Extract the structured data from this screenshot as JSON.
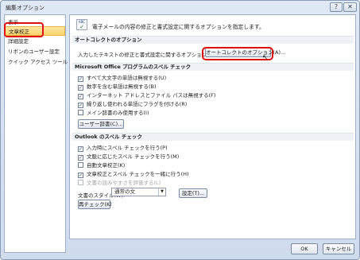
{
  "window": {
    "title": "編集オプション",
    "help": "?",
    "close": "✕"
  },
  "nav": {
    "items": [
      {
        "label": "表示"
      },
      {
        "label": "文章校正"
      },
      {
        "label": "詳細設定"
      },
      {
        "label": "リボンのユーザー設定"
      },
      {
        "label": "クイック アクセス ツール バー"
      }
    ]
  },
  "header": {
    "icon_text": "ABC",
    "description": "電子メールの内容の修正と書式設定に関するオプションを指定します。"
  },
  "autocorrect": {
    "title": "オートコレクトのオプション",
    "description": "入力したテキストの修正と書式設定に関するオプションを指定します。",
    "button": "オートコレクトのオプション(A)..."
  },
  "office_spelling": {
    "title": "Microsoft Office プログラムのスペル チェック",
    "options": [
      {
        "label": "すべて大文字の単語は無視する(U)",
        "checked": true
      },
      {
        "label": "数字を含む単語は無視する(B)",
        "checked": true
      },
      {
        "label": "インターネット アドレスとファイル パスは無視する(F)",
        "checked": true
      },
      {
        "label": "繰り返し使われる単語にフラグを付ける(R)",
        "checked": true
      },
      {
        "label": "メイン辞書のみ使用する(I)",
        "checked": false
      }
    ],
    "dictionary_button": "ユーザー辞書(C)..."
  },
  "outlook_spelling": {
    "title": "Outlook のスペル チェック",
    "options": [
      {
        "label": "入力時にスペル チェックを行う(P)",
        "checked": true,
        "disabled": false
      },
      {
        "label": "文脈に応じたスペル チェックを行う(M)",
        "checked": true,
        "disabled": false
      },
      {
        "label": "自動文章校正(K)",
        "checked": false,
        "disabled": false
      },
      {
        "label": "文章校正とスペル チェックを一緒に行う(H)",
        "checked": true,
        "disabled": false
      },
      {
        "label": "文書の読みやすさを評価する(L)",
        "checked": false,
        "disabled": true
      }
    ],
    "style_label": "文書のスタイル(W):",
    "style_value": "通常の文",
    "settings_button": "設定(T)...",
    "recheck_button": "再チェック(K)"
  },
  "footer": {
    "ok": "OK",
    "cancel": "キャンセル"
  }
}
